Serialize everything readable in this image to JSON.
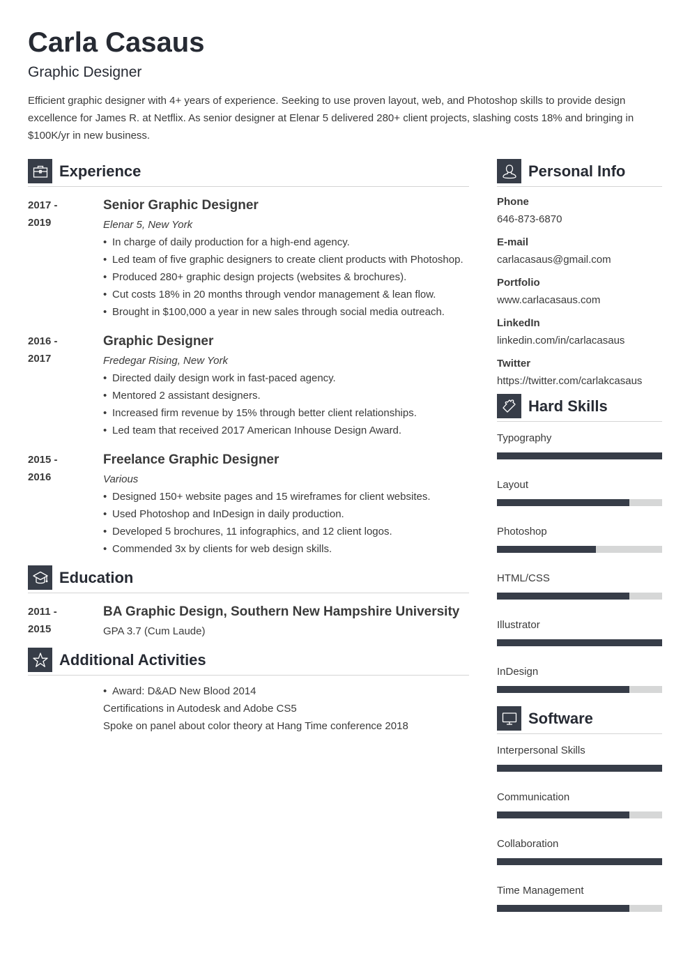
{
  "header": {
    "name": "Carla Casaus",
    "role": "Graphic Designer",
    "summary": "Efficient graphic designer with 4+ years of experience. Seeking to use proven layout, web, and Photoshop skills to provide design excellence for James R. at Netflix. As senior designer at Elenar 5 delivered 280+ client projects, slashing costs 18% and bringing in $100K/yr in new business."
  },
  "colors": {
    "accent": "#373d48",
    "bar_track": "#d6d7d7",
    "text": "#3a3a3a",
    "heading": "#262a33"
  },
  "experience": {
    "title": "Experience",
    "icon": "briefcase-icon",
    "entries": [
      {
        "date_start": "2017 -",
        "date_end": "2019",
        "title": "Senior Graphic Designer",
        "company": "Elenar 5, New York",
        "bullets": [
          "In charge of daily production for a high-end agency.",
          "Led team of five graphic designers to create client products with Photoshop.",
          "Produced 280+ graphic design projects (websites & brochures).",
          "Cut costs 18% in 20 months through vendor management & lean flow.",
          "Brought in $100,000 a year in new sales through social media outreach."
        ]
      },
      {
        "date_start": "2016 -",
        "date_end": "2017",
        "title": "Graphic Designer",
        "company": "Fredegar Rising, New York",
        "bullets": [
          "Directed daily design work in fast-paced agency.",
          "Mentored 2 assistant designers.",
          "Increased firm revenue by 15% through better client relationships.",
          "Led team that received 2017 American Inhouse Design Award."
        ]
      },
      {
        "date_start": "2015 -",
        "date_end": "2016",
        "title": "Freelance Graphic Designer",
        "company": "Various",
        "bullets": [
          "Designed 150+ website pages and 15 wireframes for client websites.",
          "Used Photoshop and InDesign in daily production.",
          "Developed 5 brochures, 11 infographics, and 12 client logos.",
          "Commended 3x by clients for web design skills."
        ]
      }
    ]
  },
  "education": {
    "title": "Education",
    "icon": "graduation-cap-icon",
    "entries": [
      {
        "date_start": "2011 -",
        "date_end": "2015",
        "degree": "BA Graphic Design, Southern New Hampshire University",
        "detail": "GPA 3.7 (Cum Laude)"
      }
    ]
  },
  "activities": {
    "title": "Additional Activities",
    "icon": "star-icon",
    "bullets": [
      "Award: D&AD New Blood 2014"
    ],
    "lines": [
      "Certifications in Autodesk and Adobe CS5",
      "Spoke on panel about color theory at Hang Time conference 2018"
    ]
  },
  "personal_info": {
    "title": "Personal Info",
    "icon": "user-icon",
    "items": [
      {
        "label": "Phone",
        "value": "646-873-6870"
      },
      {
        "label": "E-mail",
        "value": "carlacasaus@gmail.com"
      },
      {
        "label": "Portfolio",
        "value": "www.carlacasaus.com"
      },
      {
        "label": "LinkedIn",
        "value": "linkedin.com/in/carlacasaus"
      },
      {
        "label": "Twitter",
        "value": "https://twitter.com/carlakcasaus"
      }
    ]
  },
  "hard_skills": {
    "title": "Hard Skills",
    "icon": "puzzle-piece-icon",
    "items": [
      {
        "label": "Typography",
        "level_percent": 100
      },
      {
        "label": "Layout",
        "level_percent": 80
      },
      {
        "label": "Photoshop",
        "level_percent": 60
      },
      {
        "label": "HTML/CSS",
        "level_percent": 80
      },
      {
        "label": "Illustrator",
        "level_percent": 100
      },
      {
        "label": "InDesign",
        "level_percent": 80
      }
    ]
  },
  "software": {
    "title": "Software",
    "icon": "monitor-icon",
    "items": [
      {
        "label": "Interpersonal Skills",
        "level_percent": 100
      },
      {
        "label": "Communication",
        "level_percent": 80
      },
      {
        "label": "Collaboration",
        "level_percent": 100
      },
      {
        "label": "Time Management",
        "level_percent": 80
      }
    ]
  }
}
